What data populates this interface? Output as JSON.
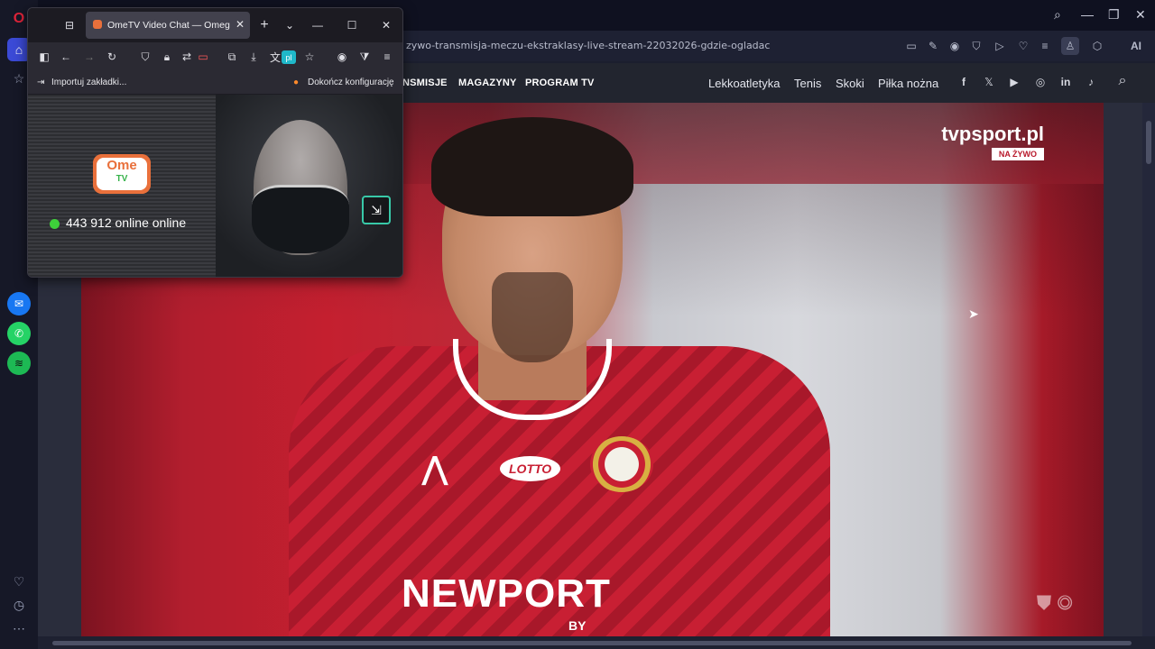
{
  "opera": {
    "url": "zywo-transmisja-meczu-ekstraklasy-live-stream-22032026-gdzie-ogladac",
    "ai_label": "AI"
  },
  "site": {
    "nav_bold": [
      "NSMISJE",
      "MAGAZYNY",
      "PROGRAM TV"
    ],
    "nav_light": [
      "Lekkoatletyka",
      "Tenis",
      "Skoki",
      "Piłka nożna"
    ],
    "social_icons": [
      "facebook-icon",
      "x-icon",
      "youtube-icon",
      "instagram-icon",
      "linkedin-icon",
      "tiktok-icon"
    ]
  },
  "video": {
    "logo": "tvpsport.pl",
    "live_badge": "NA ŻYWO",
    "sponsor": "NEWPORT",
    "sponsor_sub": "BY",
    "shirt_sponsor_small": "LOTTO"
  },
  "firefox": {
    "tab_title": "OmeTV Video Chat — Omegle Alter",
    "translate_badge": "pl",
    "bookmarks": {
      "import": "Importuj zakładki...",
      "finish_setup": "Dokończ konfigurację"
    }
  },
  "ome": {
    "logo_top": "Ome",
    "logo_bottom": "TV",
    "online_text": "443 912 online online"
  },
  "colors": {
    "opera_bg": "#161827",
    "ome_orange": "#e9703b",
    "online_green": "#3ed13a",
    "pip_accent": "#38c9a8"
  }
}
